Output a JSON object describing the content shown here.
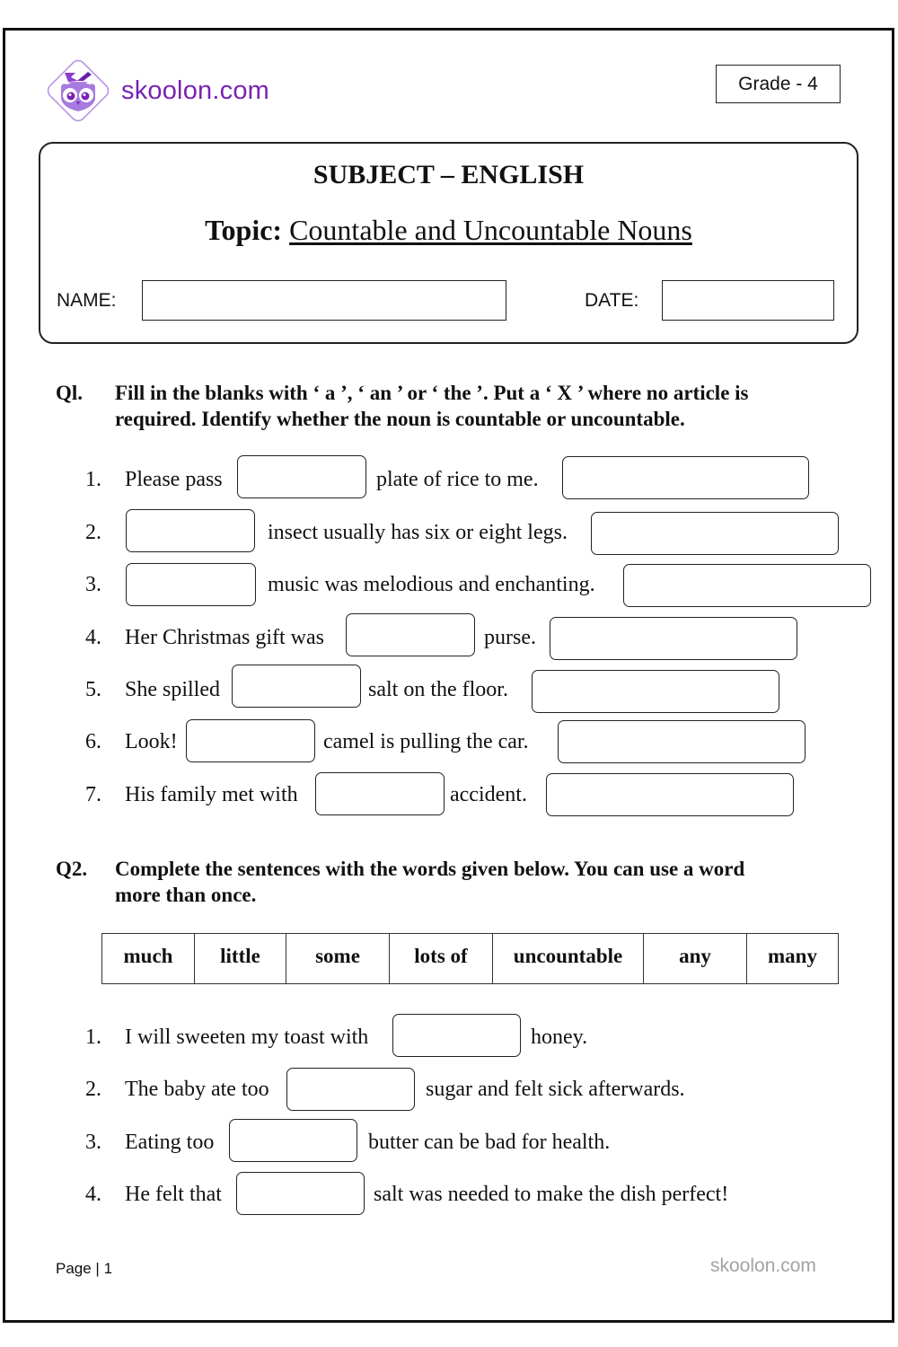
{
  "brand": {
    "logo_text": "skoolon.com",
    "logo_icon": "owl-logo-icon",
    "accent_color": "#7a22b5",
    "logo_light_color": "#a77be0"
  },
  "grade": "Grade - 4",
  "header": {
    "subject": "SUBJECT – ENGLISH",
    "topic_label": "Topic:",
    "topic_value": "Countable and Uncountable Nouns",
    "name_label": "NAME:",
    "name_value": "",
    "date_label": "DATE:",
    "date_value": ""
  },
  "q1": {
    "number": "Ql.",
    "instruction_line1": "Fill in the blanks with ‘ a ’, ‘ an ’ or ‘ the ’. Put a ‘ X ’ where no article is",
    "instruction_line2": "required. Identify whether the noun is countable or uncountable.",
    "items": [
      {
        "num": "1.",
        "before": "Please pass",
        "after": "plate of rice to me.",
        "answer": "",
        "type_answer": ""
      },
      {
        "num": "2.",
        "before": "",
        "after": "insect usually has six or eight legs.",
        "answer": "",
        "type_answer": ""
      },
      {
        "num": "3.",
        "before": "",
        "after": "music was melodious and enchanting.",
        "answer": "",
        "type_answer": ""
      },
      {
        "num": "4.",
        "before": "Her Christmas gift was",
        "after": "purse.",
        "answer": "",
        "type_answer": ""
      },
      {
        "num": "5.",
        "before": "She spilled",
        "after": "salt on the floor.",
        "answer": "",
        "type_answer": ""
      },
      {
        "num": "6.",
        "before": "Look!",
        "after": "camel is pulling the car.",
        "answer": "",
        "type_answer": ""
      },
      {
        "num": "7.",
        "before": "His family met with",
        "after": "accident.",
        "answer": "",
        "type_answer": ""
      }
    ]
  },
  "q2": {
    "number": "Q2.",
    "instruction_line1": "Complete the sentences with the words given below. You can use a word",
    "instruction_line2": "more than once.",
    "words": [
      "much",
      "little",
      "some",
      "lots of",
      "uncountable",
      "any",
      "many"
    ],
    "items": [
      {
        "num": "1.",
        "before": "I will sweeten my toast with",
        "after": "honey.",
        "answer": ""
      },
      {
        "num": "2.",
        "before": "The baby ate too",
        "after": "sugar and felt sick afterwards.",
        "answer": ""
      },
      {
        "num": "3.",
        "before": "Eating too",
        "after": "butter can be bad for health.",
        "answer": ""
      },
      {
        "num": "4.",
        "before": "He felt that",
        "after": "salt was needed to make the dish perfect!",
        "answer": ""
      }
    ]
  },
  "footer": {
    "page_label": "Page | 1",
    "site": "skoolon.com"
  }
}
